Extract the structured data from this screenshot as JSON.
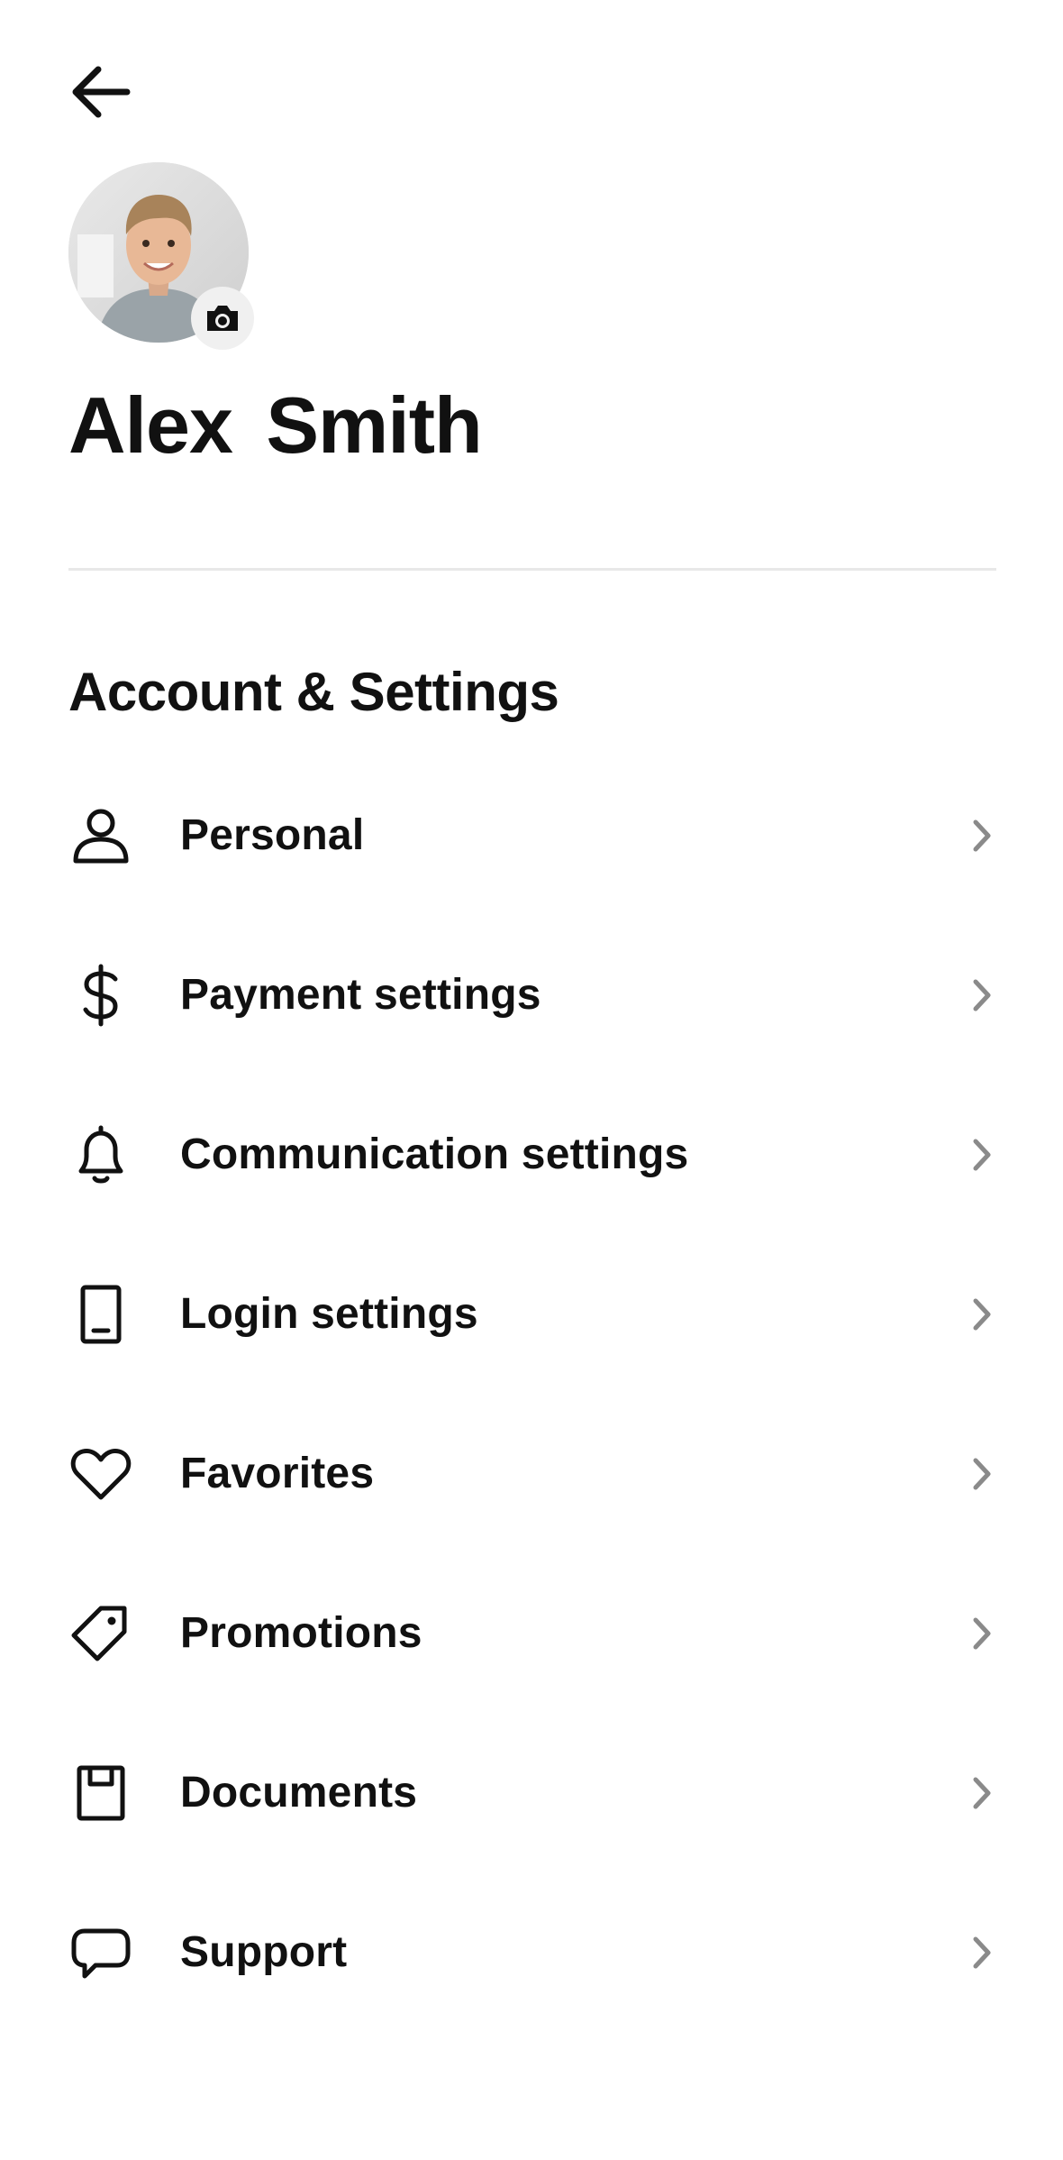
{
  "header": {
    "back_icon": "arrow-left-icon"
  },
  "profile": {
    "name": "Alex Smith",
    "avatar_icon": "user-photo",
    "camera_icon": "camera-icon"
  },
  "section": {
    "title": "Account & Settings"
  },
  "menu": {
    "items": [
      {
        "label": "Personal",
        "icon": "person-icon"
      },
      {
        "label": "Payment settings",
        "icon": "dollar-icon"
      },
      {
        "label": "Communication settings",
        "icon": "bell-icon"
      },
      {
        "label": "Login settings",
        "icon": "phone-icon"
      },
      {
        "label": "Favorites",
        "icon": "heart-icon"
      },
      {
        "label": "Promotions",
        "icon": "tag-icon"
      },
      {
        "label": "Documents",
        "icon": "document-icon"
      },
      {
        "label": "Support",
        "icon": "chat-bubble-icon"
      }
    ],
    "chevron_icon": "chevron-right-icon"
  },
  "colors": {
    "text": "#111111",
    "chevron": "#8a8a8a",
    "divider": "#e8e8e8",
    "background": "#ffffff"
  }
}
